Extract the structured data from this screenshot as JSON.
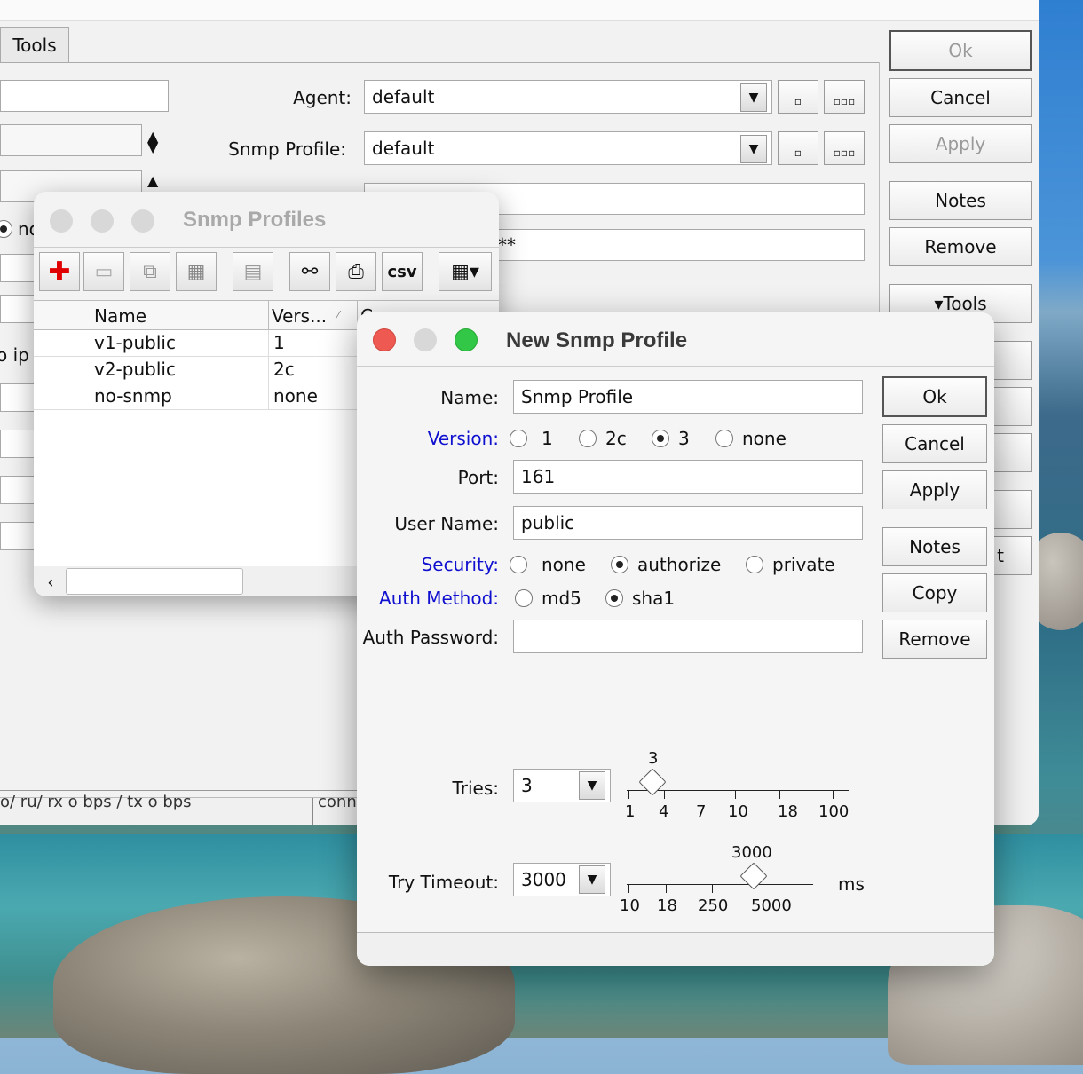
{
  "bg_window": {
    "tab_tools": "Tools",
    "agent_label": "Agent:",
    "agent_value": "default",
    "snmp_profile_label": "Snmp Profile:",
    "snmp_profile_value": "default",
    "partial_radio_text": "no",
    "partial_ip_text": "o ip",
    "masked_password": "**",
    "status_text": "o/ ru/ rx o bps / tx o bps",
    "status_text2": "conn",
    "buttons": {
      "ok": "Ok",
      "cancel": "Cancel",
      "apply": "Apply",
      "notes": "Notes",
      "remove": "Remove",
      "tools": "▾Tools",
      "partial_t": "t"
    }
  },
  "profiles_window": {
    "title": "Snmp Profiles",
    "toolbar": {
      "csv": "csv"
    },
    "columns": [
      "Name",
      "Vers...",
      "Co..."
    ],
    "rows": [
      {
        "name": "v1-public",
        "version": "1"
      },
      {
        "name": "v2-public",
        "version": "2c"
      },
      {
        "name": "no-snmp",
        "version": "none"
      }
    ]
  },
  "dialog": {
    "title": "New Snmp Profile",
    "name_label": "Name:",
    "name_value": "Snmp Profile",
    "version_label": "Version:",
    "version_options": [
      "1",
      "2c",
      "3",
      "none"
    ],
    "version_selected": "3",
    "port_label": "Port:",
    "port_value": "161",
    "user_label": "User Name:",
    "user_value": "public",
    "security_label": "Security:",
    "security_options": [
      "none",
      "authorize",
      "private"
    ],
    "security_selected": "authorize",
    "auth_method_label": "Auth Method:",
    "auth_method_options": [
      "md5",
      "sha1"
    ],
    "auth_method_selected": "sha1",
    "auth_password_label": "Auth Password:",
    "auth_password_value": "",
    "tries_label": "Tries:",
    "tries_value": "3",
    "tries_slider_value": "3",
    "tries_ticks": [
      "1",
      "4",
      "7",
      "10",
      "18",
      "100"
    ],
    "timeout_label": "Try Timeout:",
    "timeout_value": "3000",
    "timeout_slider_value": "3000",
    "timeout_ticks": [
      "10",
      "18",
      "250",
      "5000"
    ],
    "timeout_unit": "ms",
    "buttons": {
      "ok": "Ok",
      "cancel": "Cancel",
      "apply": "Apply",
      "notes": "Notes",
      "copy": "Copy",
      "remove": "Remove"
    }
  }
}
